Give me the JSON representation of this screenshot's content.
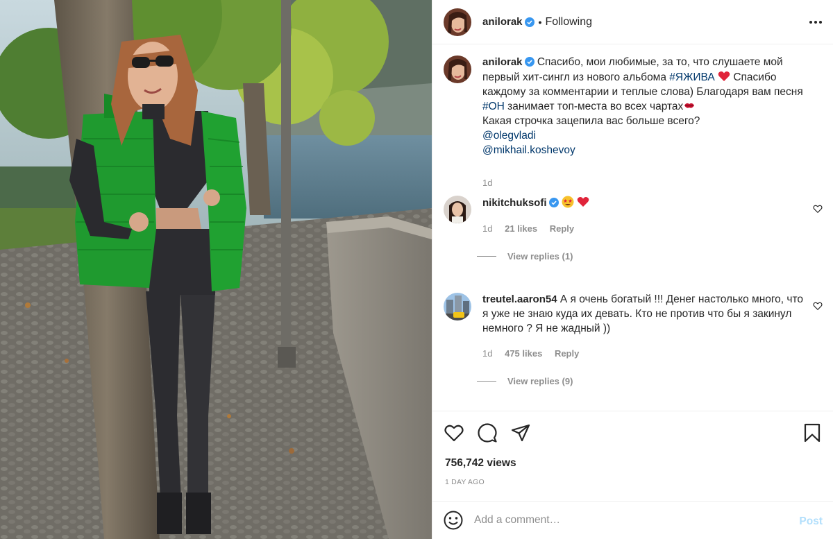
{
  "header": {
    "username": "anilorak",
    "separator": "•",
    "follow_status": "Following"
  },
  "caption": {
    "username": "anilorak",
    "text_before_tag1": "Спасибо, мои любимые, за то, что слушаете мой первый хит-сингл из нового альбома ",
    "tag1": "#ЯЖИВА",
    "text_after_tag1": " Спасибо каждому за комментарии и теплые слова) Благодаря вам песня ",
    "tag2": "#ОН",
    "text_after_tag2": " занимает топ-места во всех чартах",
    "line2": "Какая строчка зацепила вас больше всего?",
    "mention1": "@olegvladi",
    "mention2": "@mikhail.koshevoy",
    "time": "1d"
  },
  "comments": [
    {
      "username": "nikitchuksofi",
      "time": "1d",
      "likes": "21 likes",
      "reply_label": "Reply",
      "view_replies": "View replies (1)"
    },
    {
      "username": "treutel.aaron54",
      "text": "А я очень богатый !!! Денег настолько много, что я уже не знаю куда их девать. Кто не против что бы я закинул немного ? Я не жадный ))",
      "time": "1d",
      "likes": "475 likes",
      "reply_label": "Reply",
      "view_replies": "View replies (9)"
    }
  ],
  "actions": {
    "views": "756,742 views",
    "posted": "1 DAY AGO"
  },
  "add_comment": {
    "placeholder": "Add a comment…",
    "post_label": "Post"
  },
  "colors": {
    "text": "#262626",
    "secondary": "#8e8e8e",
    "link": "#00376b",
    "verified": "#3897f0",
    "post_disabled": "#b2dffc",
    "heart": "#ed4956"
  },
  "icons": [
    "verified-icon",
    "more-icon",
    "heart-icon",
    "comment-icon",
    "share-icon",
    "bookmark-icon",
    "emoji-icon",
    "like-comment-icon"
  ]
}
